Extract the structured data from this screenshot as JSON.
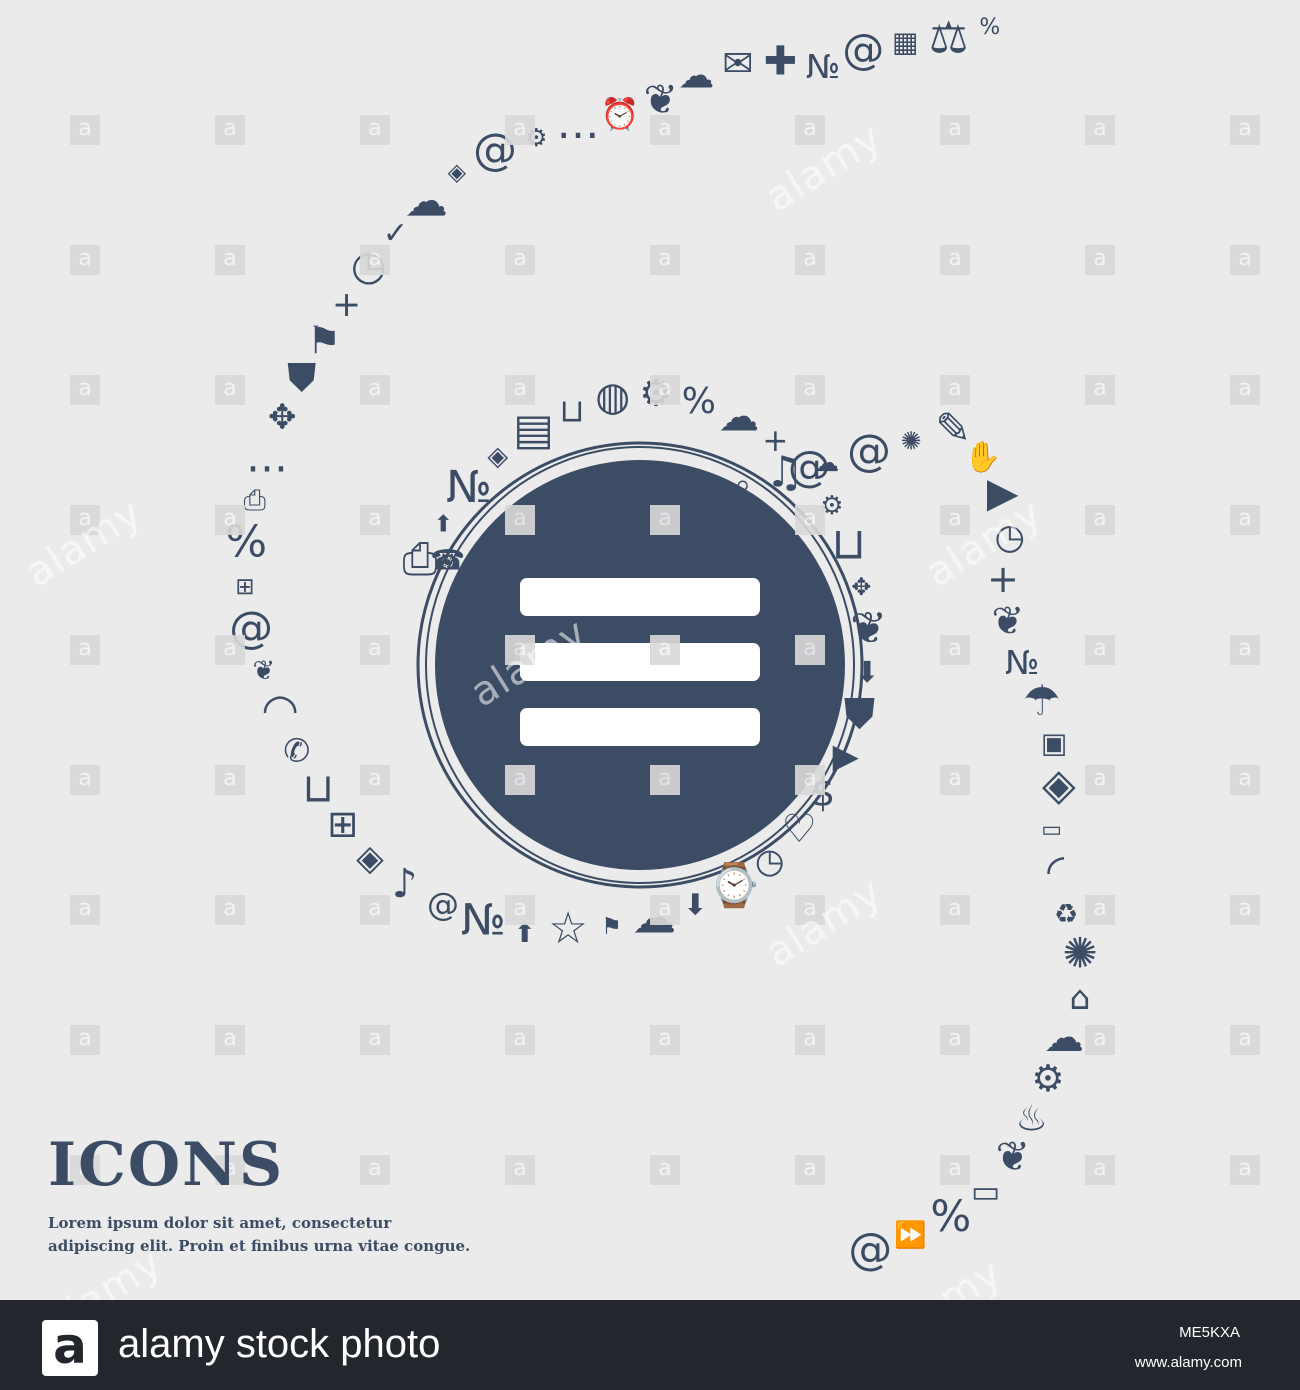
{
  "heading": {
    "title": "ICONS"
  },
  "caption": {
    "line1": "Lorem ipsum dolor sit amet, consectetur",
    "line2": "adipiscing elit. Proin et finibus urna vitae congue."
  },
  "watermark": {
    "letter": "a",
    "word": "alamy"
  },
  "footer": {
    "logo": "a",
    "text": "alamy stock photo",
    "image_id": "ME5KXA",
    "site": "www.alamy.com"
  },
  "center": {
    "icon": "hamburger-menu-icon"
  },
  "spiral_icons": [
    {
      "icon": "percent-icon",
      "glyph": "%"
    },
    {
      "icon": "scales-icon",
      "glyph": "⚖"
    },
    {
      "icon": "calendar-icon",
      "glyph": "▦"
    },
    {
      "icon": "at-sign-icon",
      "glyph": "@"
    },
    {
      "icon": "number-sign-icon",
      "glyph": "№"
    },
    {
      "icon": "gamepad-icon",
      "glyph": "✚"
    },
    {
      "icon": "envelope-icon",
      "glyph": "✉"
    },
    {
      "icon": "cloud-icon",
      "glyph": "☁"
    },
    {
      "icon": "butterfly-icon",
      "glyph": "❦"
    },
    {
      "icon": "alarm-clock-icon",
      "glyph": "⏰"
    },
    {
      "icon": "speech-bubble-icon",
      "glyph": "…"
    },
    {
      "icon": "gears-icon",
      "glyph": "⚙"
    },
    {
      "icon": "at-sign-icon",
      "glyph": "@"
    },
    {
      "icon": "compass-icon",
      "glyph": "◈"
    },
    {
      "icon": "cloud-icon",
      "glyph": "☁"
    },
    {
      "icon": "check-icon",
      "glyph": "✓"
    },
    {
      "icon": "clock-icon",
      "glyph": "◷"
    },
    {
      "icon": "plus-icon",
      "glyph": "+"
    },
    {
      "icon": "flag-icon",
      "glyph": "⚑"
    },
    {
      "icon": "police-badge-icon",
      "glyph": "⛊"
    },
    {
      "icon": "maple-leaf-icon",
      "glyph": "✥"
    },
    {
      "icon": "speech-bubble-icon",
      "glyph": "…"
    },
    {
      "icon": "printer-icon",
      "glyph": "⎙"
    },
    {
      "icon": "percent-icon",
      "glyph": "%"
    },
    {
      "icon": "gift-icon",
      "glyph": "⊞"
    },
    {
      "icon": "at-sign-icon",
      "glyph": "@"
    },
    {
      "icon": "butterfly-icon",
      "glyph": "❦"
    },
    {
      "icon": "wifi-icon",
      "glyph": "◠"
    },
    {
      "icon": "phone-icon",
      "glyph": "✆"
    },
    {
      "icon": "shopping-cart-icon",
      "glyph": "⊔"
    },
    {
      "icon": "gift-icon",
      "glyph": "⊞"
    },
    {
      "icon": "compass-icon",
      "glyph": "◈"
    },
    {
      "icon": "music-note-icon",
      "glyph": "♪"
    },
    {
      "icon": "at-sign-icon",
      "glyph": "@"
    },
    {
      "icon": "number-sign-icon",
      "glyph": "№"
    },
    {
      "icon": "upload-arrow-icon",
      "glyph": "⬆"
    },
    {
      "icon": "star-icon",
      "glyph": "☆"
    },
    {
      "icon": "flag-icon",
      "glyph": "⚑"
    },
    {
      "icon": "cloud-icon",
      "glyph": "☁"
    },
    {
      "icon": "download-arrow-icon",
      "glyph": "⬇"
    },
    {
      "icon": "watch-icon",
      "glyph": "⌚"
    },
    {
      "icon": "clock-icon",
      "glyph": "◷"
    },
    {
      "icon": "heart-plus-icon",
      "glyph": "♡"
    },
    {
      "icon": "dollar-icon",
      "glyph": "$"
    },
    {
      "icon": "play-button-icon",
      "glyph": "▶"
    },
    {
      "icon": "police-badge-icon",
      "glyph": "⛊"
    },
    {
      "icon": "floppy-download-icon",
      "glyph": "⬇"
    },
    {
      "icon": "butterfly-icon",
      "glyph": "❦"
    },
    {
      "icon": "maple-leaf-icon",
      "glyph": "✥"
    },
    {
      "icon": "shopping-basket-icon",
      "glyph": "⊔"
    },
    {
      "icon": "gears-icon",
      "glyph": "⚙"
    },
    {
      "icon": "at-sign-icon",
      "glyph": "@"
    },
    {
      "icon": "plus-icon",
      "glyph": "+"
    },
    {
      "icon": "cloud-icon",
      "glyph": "☁"
    },
    {
      "icon": "percent-icon",
      "glyph": "%"
    },
    {
      "icon": "settings-bubble-icon",
      "glyph": "⚙"
    },
    {
      "icon": "cursor-globe-icon",
      "glyph": "◍"
    },
    {
      "icon": "shopping-basket-icon",
      "glyph": "⊔"
    },
    {
      "icon": "calculator-icon",
      "glyph": "▤"
    },
    {
      "icon": "compass-icon",
      "glyph": "◈"
    },
    {
      "icon": "number-sign-icon",
      "glyph": "№"
    },
    {
      "icon": "floppy-upload-icon",
      "glyph": "⬆"
    },
    {
      "icon": "printer-icon",
      "glyph": "⎙"
    },
    {
      "icon": "telephone-icon",
      "glyph": "☎"
    },
    {
      "icon": "speech-bubble-icon",
      "glyph": "…"
    },
    {
      "icon": "play-button-icon",
      "glyph": "▶"
    },
    {
      "icon": "heart-plus-icon",
      "glyph": "♡"
    },
    {
      "icon": "at-sign-icon",
      "glyph": "@"
    },
    {
      "icon": "satellite-dish-icon",
      "glyph": "◜"
    },
    {
      "icon": "maple-leaf-icon",
      "glyph": "✥"
    },
    {
      "icon": "magnifier-plus-icon",
      "glyph": "⌕"
    },
    {
      "icon": "music-note-icon",
      "glyph": "♫"
    },
    {
      "icon": "cloud-icon",
      "glyph": "☁"
    },
    {
      "icon": "at-sign-icon",
      "glyph": "@"
    },
    {
      "icon": "gear-icon",
      "glyph": "✺"
    },
    {
      "icon": "notepad-pencil-icon",
      "glyph": "✎"
    },
    {
      "icon": "hand-icon",
      "glyph": "✋"
    },
    {
      "icon": "play-button-icon",
      "glyph": "▶"
    },
    {
      "icon": "stopwatch-icon",
      "glyph": "◷"
    },
    {
      "icon": "plus-icon",
      "glyph": "+"
    },
    {
      "icon": "butterfly-icon",
      "glyph": "❦"
    },
    {
      "icon": "number-sign-icon",
      "glyph": "№"
    },
    {
      "icon": "umbrella-icon",
      "glyph": "☂"
    },
    {
      "icon": "floppy-disk-icon",
      "glyph": "▣"
    },
    {
      "icon": "compass-icon",
      "glyph": "◈"
    },
    {
      "icon": "monitor-icon",
      "glyph": "▭"
    },
    {
      "icon": "satellite-dish-icon",
      "glyph": "◜"
    },
    {
      "icon": "recycle-icon",
      "glyph": "♻"
    },
    {
      "icon": "sparkle-icon",
      "glyph": "✺"
    },
    {
      "icon": "home-icon",
      "glyph": "⌂"
    },
    {
      "icon": "cloud-icon",
      "glyph": "☁"
    },
    {
      "icon": "gears-icon",
      "glyph": "⚙"
    },
    {
      "icon": "chef-hat-icon",
      "glyph": "♨"
    },
    {
      "icon": "butterfly-icon",
      "glyph": "❦"
    },
    {
      "icon": "microwave-icon",
      "glyph": "▭"
    },
    {
      "icon": "percent-icon",
      "glyph": "%"
    },
    {
      "icon": "fast-forward-icon",
      "glyph": "⏩"
    },
    {
      "icon": "at-sign-icon",
      "glyph": "@"
    }
  ]
}
